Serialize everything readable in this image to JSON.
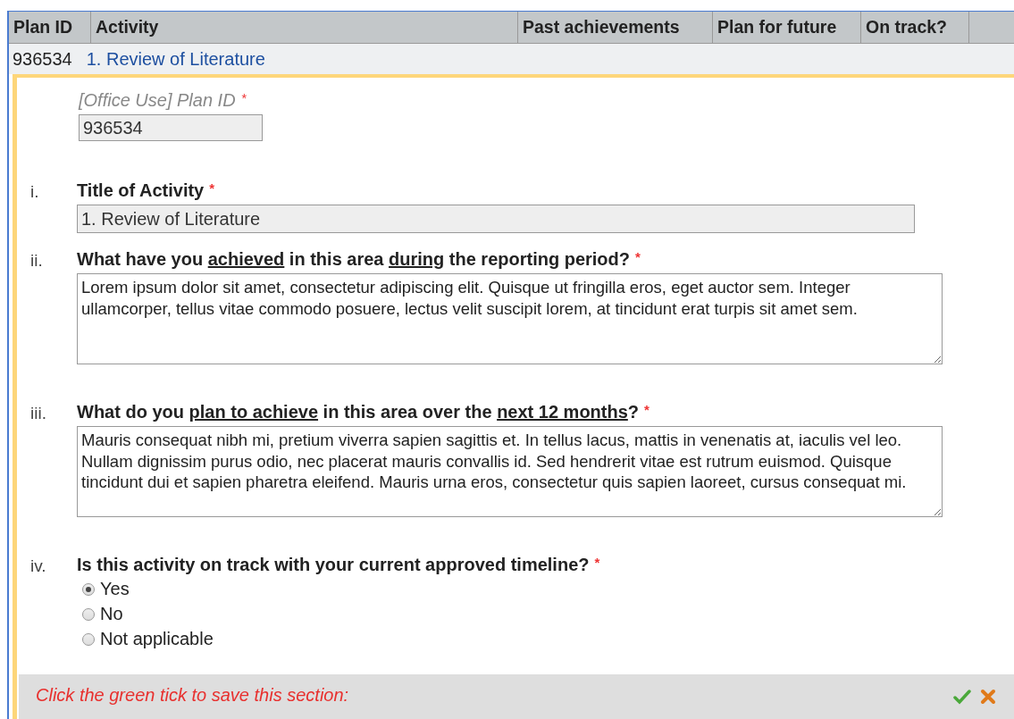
{
  "table": {
    "columns": [
      "Plan ID",
      "Activity",
      "Past achievements",
      "Plan for future",
      "On track?"
    ],
    "row": {
      "plan_id": "936534",
      "activity": "1. Review of Literature",
      "expanded": true
    }
  },
  "form": {
    "office_field": {
      "label": "[Office Use] Plan ID",
      "required_mark": "*",
      "value": "936534"
    },
    "questions": [
      {
        "number": "i.",
        "kind": "text",
        "label": [
          {
            "text": "Title of Activity",
            "underline": false
          }
        ],
        "required_mark": "*",
        "value": "1. Review of Literature",
        "disabled": true
      },
      {
        "number": "ii.",
        "kind": "textarea",
        "label": [
          {
            "text": "What have you ",
            "underline": false
          },
          {
            "text": "achieved",
            "underline": true
          },
          {
            "text": " in this area ",
            "underline": false
          },
          {
            "text": "during",
            "underline": true
          },
          {
            "text": " the reporting period?",
            "underline": false
          }
        ],
        "required_mark": "*",
        "value": "Lorem ipsum dolor sit amet, consectetur adipiscing elit. Quisque ut fringilla eros, eget auctor sem. Integer ullamcorper, tellus vitae commodo posuere, lectus velit suscipit lorem, at tincidunt erat turpis sit amet sem."
      },
      {
        "number": "iii.",
        "kind": "textarea",
        "label": [
          {
            "text": "What do you ",
            "underline": false
          },
          {
            "text": "plan to achieve",
            "underline": true
          },
          {
            "text": " in this area over the ",
            "underline": false
          },
          {
            "text": "next 12 months",
            "underline": true
          },
          {
            "text": "?",
            "underline": false
          }
        ],
        "required_mark": "*",
        "value": "Mauris consequat nibh mi, pretium viverra sapien sagittis et. In tellus lacus, mattis in venenatis at, iaculis vel leo. Nullam dignissim purus odio, nec placerat mauris convallis id. Sed hendrerit vitae est rutrum euismod. Quisque tincidunt dui et sapien pharetra eleifend. Mauris urna eros, consectetur quis sapien laoreet, cursus consequat mi."
      },
      {
        "number": "iv.",
        "kind": "radio",
        "label": [
          {
            "text": "Is this activity on track with your current approved timeline?",
            "underline": false
          }
        ],
        "required_mark": "*",
        "options": [
          {
            "label": "Yes",
            "selected": true
          },
          {
            "label": "No",
            "selected": false
          },
          {
            "label": "Not applicable",
            "selected": false
          }
        ]
      }
    ]
  },
  "footer": {
    "hint": "Click the green tick to save this section:"
  }
}
